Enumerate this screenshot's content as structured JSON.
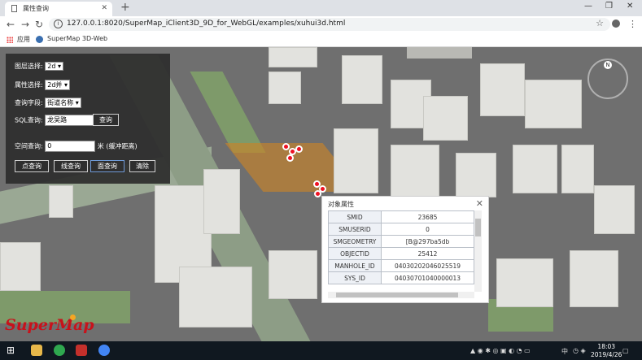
{
  "browser": {
    "tab_title": "属性查询",
    "url": "127.0.0.1:8020/SuperMap_iClient3D_9D_for_WebGL/examples/xuhui3d.html",
    "bookmarks": [
      "应用",
      "SuperMap 3D-Web"
    ]
  },
  "panel": {
    "layer_label": "图层选择:",
    "layer_value": "2d",
    "attr_label": "属性选择:",
    "attr_value": "2d并",
    "field_label": "查询字段:",
    "field_value": "街道名称",
    "sql_label": "SQL查询:",
    "sql_value": "龙吴路",
    "sql_button": "查询",
    "space_label": "空间查询:",
    "space_value": "0",
    "space_unit": "米",
    "space_hint": "(缓冲距离)",
    "buttons": [
      "点查询",
      "线查询",
      "面查询",
      "清除"
    ],
    "active_button": "面查询"
  },
  "dialog": {
    "title": "对象属性",
    "rows": [
      {
        "key": "SMID",
        "value": "23685"
      },
      {
        "key": "SMUSERID",
        "value": "0"
      },
      {
        "key": "SMGEOMETRY",
        "value": "[B@297ba5db"
      },
      {
        "key": "OBJECTID",
        "value": "25412"
      },
      {
        "key": "MANHOLE_ID",
        "value": "04030202046025519"
      },
      {
        "key": "SYS_ID",
        "value": "04030701040000013"
      }
    ]
  },
  "compass": {
    "north": "N"
  },
  "logo": "SuperMap",
  "taskbar": {
    "time": "18:03",
    "date": "2019/4/26",
    "lang": "中"
  },
  "colors": {
    "accent": "#c8121b",
    "highlight": "#c88228"
  }
}
